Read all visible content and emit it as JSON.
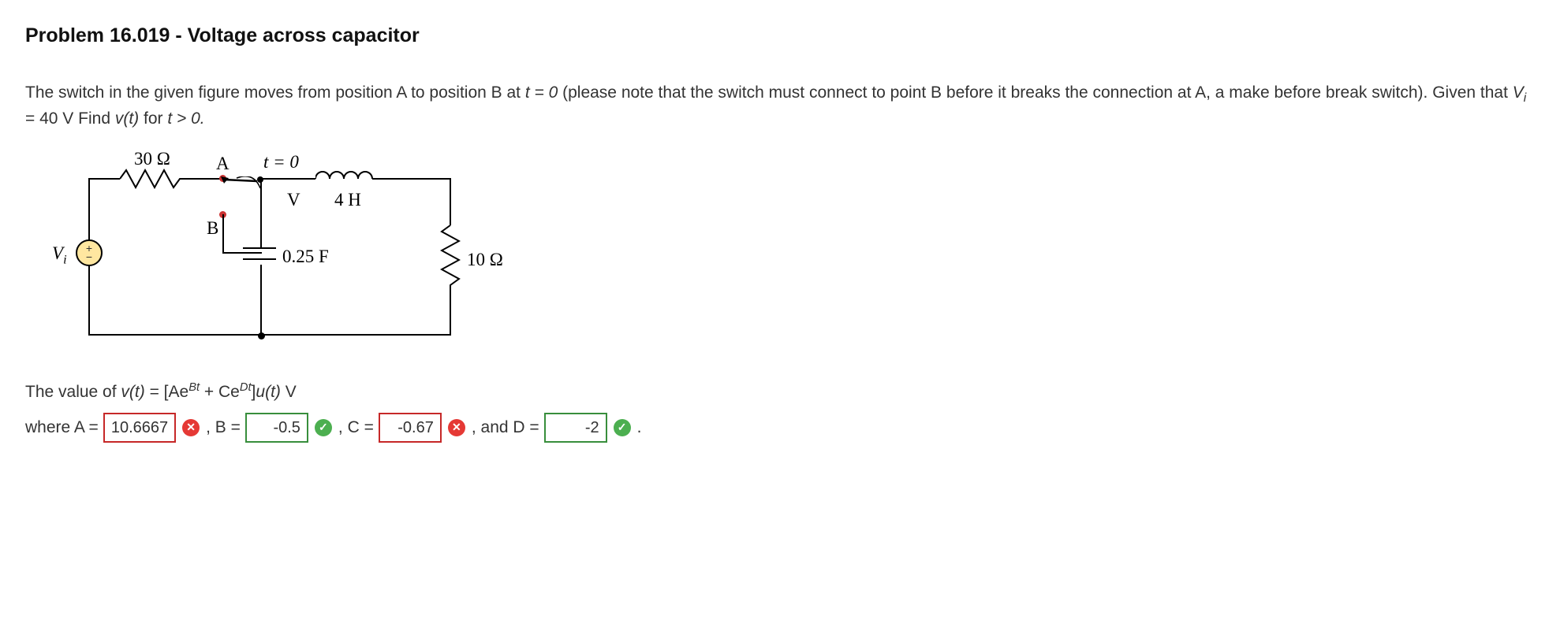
{
  "title": "Problem 16.019 - Voltage across capacitor",
  "problem": {
    "pre": "The switch in the given figure moves from position A to position B at ",
    "t0": "t = 0",
    "mid": " (please note that the switch must connect to point B before it breaks the connection at A, a make before break switch). Given that ",
    "vieq": "V",
    "visub": "i",
    "vival": " = 40 V",
    "post": " Find ",
    "vt": "v(t)",
    "tail": " for ",
    "tgt": "t > 0."
  },
  "circuit": {
    "r30": "30 Ω",
    "labelA": "A",
    "labelB": "B",
    "t0": "t = 0",
    "V": "V",
    "L": "4 H",
    "C": "0.25 F",
    "R10": "10 Ω",
    "Vi": "V",
    "Visub": "i",
    "plus": "+",
    "minus": "−"
  },
  "formula": {
    "lead": "The value of ",
    "vt": "v(t)",
    "eq": " = [Ae",
    "Bexp": "Bt",
    "plus": " + Ce",
    "Dexp": "Dt",
    "close": "]",
    "ut": "u(t)",
    "unit": " V"
  },
  "answers": {
    "where": "where A =",
    "Blabel": ", B =",
    "Clabel": ", C =",
    "Dlabel": ", and D =",
    "period": " .",
    "A": {
      "value": "10.6667",
      "correct": false
    },
    "B": {
      "value": "-0.5",
      "correct": true
    },
    "C": {
      "value": "-0.67",
      "correct": false
    },
    "D": {
      "value": "-2",
      "correct": true
    }
  }
}
